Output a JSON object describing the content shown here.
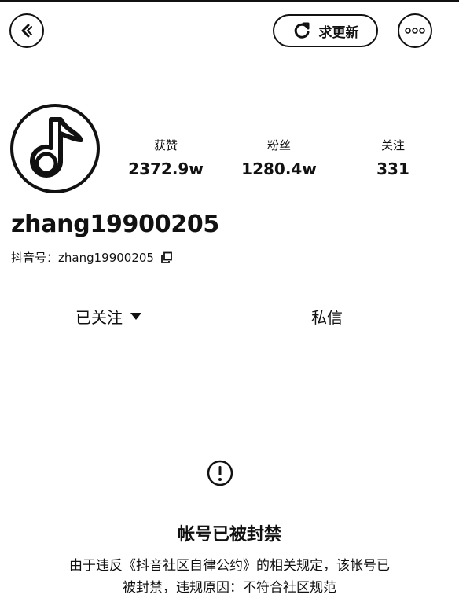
{
  "header": {
    "back_icon": "chevron-left-icon",
    "update_label": "求更新",
    "update_icon": "refresh-icon",
    "more_icon": "more-dots-icon"
  },
  "profile": {
    "avatar_icon": "music-note-icon",
    "stats": [
      {
        "label": "获赞",
        "value": "2372.9w"
      },
      {
        "label": "粉丝",
        "value": "1280.4w"
      },
      {
        "label": "关注",
        "value": "331"
      }
    ],
    "username": "zhang19900205",
    "douyin_id_label": "抖音号：",
    "douyin_id": "zhang19900205",
    "copy_icon": "copy-icon"
  },
  "actions": {
    "follow_label": "已关注",
    "follow_dropdown_icon": "caret-down-icon",
    "message_label": "私信"
  },
  "notice": {
    "icon": "warning-circle-icon",
    "title": "帐号已被封禁",
    "line1": "由于违反《抖音社区自律公约》的相关规定，该帐号已",
    "line2": "被封禁，违规原因：不符合社区规范"
  }
}
